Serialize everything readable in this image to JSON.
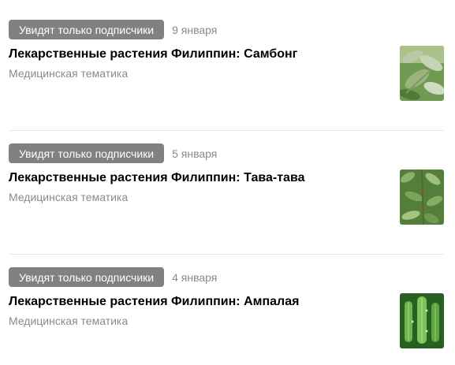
{
  "posts": [
    {
      "badge": "Увидят только подписчики",
      "date": "9 января",
      "title": "Лекарственные растения Филиппин: Самбонг",
      "category": "Медицинская тематика",
      "thumbnail_icon": "sambong-leaves-photo"
    },
    {
      "badge": "Увидят только подписчики",
      "date": "5 января",
      "title": "Лекарственные растения Филиппин: Тава-тава",
      "category": "Медицинская тематика",
      "thumbnail_icon": "tawa-tawa-plant-photo"
    },
    {
      "badge": "Увидят только подписчики",
      "date": "4 января",
      "title": "Лекарственные растения Филиппин: Ампалая",
      "category": "Медицинская тематика",
      "thumbnail_icon": "ampalaya-vine-photo"
    }
  ],
  "colors": {
    "badge_bg": "#818181",
    "muted_text": "#8a8a8a",
    "divider": "#e8e8e8"
  }
}
